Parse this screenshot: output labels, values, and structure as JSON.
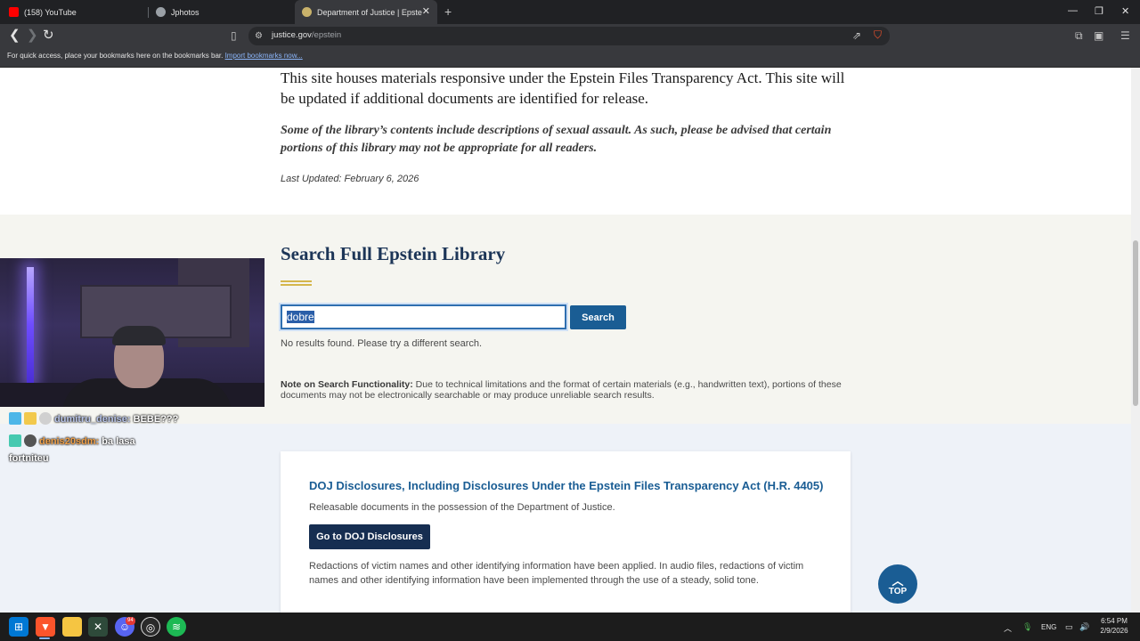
{
  "browser": {
    "tabs": [
      {
        "title": "(158) YouTube",
        "active": false,
        "favicon_color": "#ff0000"
      },
      {
        "title": "Jphotos",
        "active": false,
        "favicon_color": "#9aa0a6"
      },
      {
        "title": "Department of Justice | Epstein L",
        "active": true,
        "favicon_color": "#c9b26b"
      }
    ],
    "new_tab_symbol": "+",
    "window_controls": [
      "—",
      "❐",
      "✕"
    ],
    "url_host": "justice.gov",
    "url_path": "/epstein",
    "bookmarks_bar_text": "For quick access, place your bookmarks here on the bookmarks bar.",
    "bookmarks_bar_link": "Import bookmarks now...",
    "icons": [
      "back-icon",
      "forward-icon",
      "reload-icon",
      "bookmark-icon",
      "site-info-icon",
      "share-icon",
      "brave-shield-icon",
      "extensions-icon",
      "sidebar-icon",
      "menu-icon"
    ]
  },
  "page": {
    "intro_text": "This site houses materials responsive under the Epstein Files Transparency Act. This site will be updated if additional documents are identified for release.",
    "warning_text": "Some of the library’s contents include descriptions of sexual assault. As such, please be advised that certain portions of this library may not be appropriate for all readers.",
    "last_updated": "Last Updated: February 6, 2026",
    "search_title": "Search Full Epstein Library",
    "search_value": "dobre",
    "search_button": "Search",
    "no_results": "No results found. Please try a different search.",
    "note_label": "Note on Search Functionality:",
    "note_text": " Due to technical limitations and the format of certain materials (e.g., handwritten text), portions of these documents may not be electronically searchable or may produce unreliable search results.",
    "card_title": "DOJ Disclosures, Including Disclosures Under the Epstein Files Transparency Act (H.R. 4405)",
    "card_desc": "Releasable documents in the possession of the Department of Justice.",
    "card_button": "Go to DOJ Disclosures",
    "card_text": "Redactions of victim names and other identifying information have been applied. In audio files, redactions of victim names and other identifying information have been implemented through the use of a steady, solid tone.",
    "top_button": "TOP"
  },
  "stream_chat": [
    {
      "user": "dumitru_denise:",
      "message": " BEBE???"
    },
    {
      "user": "denis20sdm:",
      "message": " ba lasa fortniteu"
    }
  ],
  "taskbar": {
    "apps": [
      "start",
      "brave",
      "file-explorer",
      "xbox",
      "discord",
      "obs",
      "spotify"
    ],
    "discord_badge": "94",
    "language": "ENG",
    "time": "6:54 PM",
    "date": "2/9/2026"
  },
  "colors": {
    "navy": "#162e51",
    "link_blue": "#1a5d94",
    "gold": "#d4b64c"
  }
}
